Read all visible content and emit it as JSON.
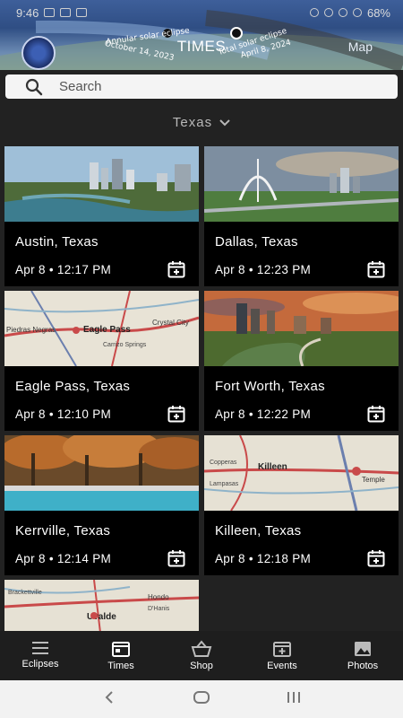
{
  "status": {
    "time": "9:46",
    "battery": "68%"
  },
  "header": {
    "title": "TIMES",
    "map_link": "Map",
    "annular_label": "Annular solar eclipse",
    "annular_date": "October 14, 2023",
    "total_label": "Total solar eclipse",
    "total_date": "April 8, 2024"
  },
  "search": {
    "placeholder": "Search"
  },
  "filter": {
    "state": "Texas"
  },
  "cards": [
    {
      "city": "Austin, Texas",
      "time": "Apr 8 • 12:17 PM",
      "image": "skyline-river"
    },
    {
      "city": "Dallas, Texas",
      "time": "Apr 8 • 12:23 PM",
      "image": "skyline-bridge"
    },
    {
      "city": "Eagle Pass, Texas",
      "time": "Apr 8 • 12:10 PM",
      "image": "map"
    },
    {
      "city": "Fort Worth, Texas",
      "time": "Apr 8 • 12:22 PM",
      "image": "skyline-sunset"
    },
    {
      "city": "Kerrville, Texas",
      "time": "Apr 8 • 12:14 PM",
      "image": "river-trees"
    },
    {
      "city": "Killeen, Texas",
      "time": "Apr 8 • 12:18 PM",
      "image": "map"
    },
    {
      "city": "Uvalde, Texas",
      "time": "",
      "image": "map"
    }
  ],
  "tabs": [
    {
      "label": "Eclipses",
      "icon": "menu-icon"
    },
    {
      "label": "Times",
      "icon": "calendar-icon",
      "active": true
    },
    {
      "label": "Shop",
      "icon": "basket-icon"
    },
    {
      "label": "Events",
      "icon": "calendar-plus-icon"
    },
    {
      "label": "Photos",
      "icon": "image-icon"
    }
  ],
  "map_labels": {
    "eagle_pass": [
      "Eagle Pass",
      "Crystal City",
      "Carrizo Springs",
      "Piedras Negras"
    ],
    "killeen": [
      "Copperas",
      "Killeen",
      "Lampasas",
      "Temple"
    ],
    "uvalde": [
      "Uvalde",
      "Hondo",
      "D'Hanis",
      "Brackettville"
    ]
  },
  "colors": {
    "background": "#222222",
    "card": "#000000",
    "tabbar": "#1e1e1e"
  }
}
